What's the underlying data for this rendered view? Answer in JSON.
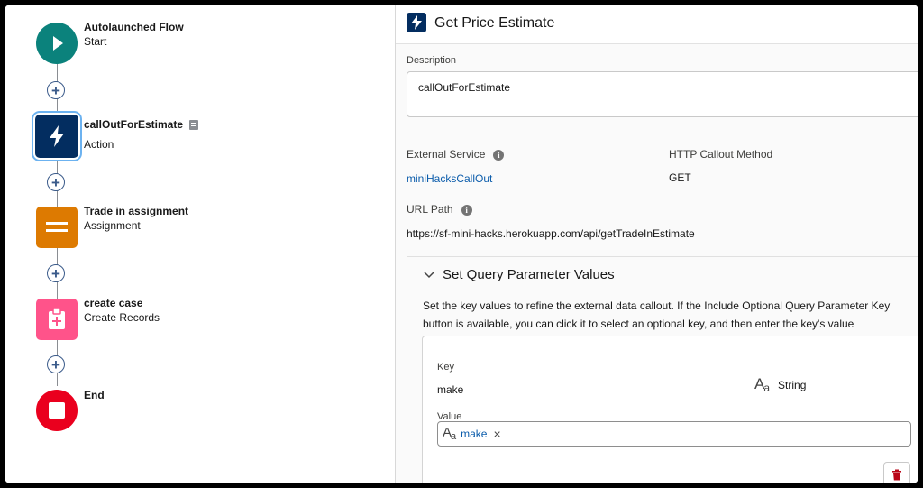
{
  "flow": {
    "nodes": [
      {
        "title": "Autolaunched Flow",
        "subtitle": "Start",
        "icon": "play-icon",
        "color": "#0b827c"
      },
      {
        "title": "callOutForEstimate",
        "subtitle": "Action",
        "icon": "lightning-icon",
        "color": "#032d60"
      },
      {
        "title": "Trade in assignment",
        "subtitle": "Assignment",
        "icon": "equals-icon",
        "color": "#dd7a01"
      },
      {
        "title": "create case",
        "subtitle": "Create Records",
        "icon": "record-create-icon",
        "color": "#ff538a"
      },
      {
        "title": "End",
        "subtitle": "",
        "icon": "stop-icon",
        "color": "#ea001e"
      }
    ],
    "add_symbol": "+"
  },
  "panel": {
    "title": "Get Price Estimate",
    "description_label": "Description",
    "description_value": "callOutForEstimate",
    "external_service_label": "External Service",
    "external_service_value": "miniHacksCallOut",
    "http_method_label": "HTTP Callout Method",
    "http_method_value": "GET",
    "url_path_label": "URL Path",
    "url_path_value": "https://sf-mini-hacks.herokuapp.com/api/getTradeInEstimate",
    "info_glyph": "i",
    "section": {
      "title": "Set Query Parameter Values",
      "help_line1": "Set the key values to refine the external data callout. If the Include Optional Query Parameter Key",
      "help_line2": "button is available, you can click it to select an optional key, and then enter the key's value",
      "param": {
        "key_label": "Key",
        "key_value": "make",
        "type_label": "String",
        "value_label": "Value",
        "value_pill": "make",
        "remove_glyph": "×"
      }
    }
  },
  "colors": {
    "accent": "#0b5cab",
    "delete": "#ba0517"
  }
}
